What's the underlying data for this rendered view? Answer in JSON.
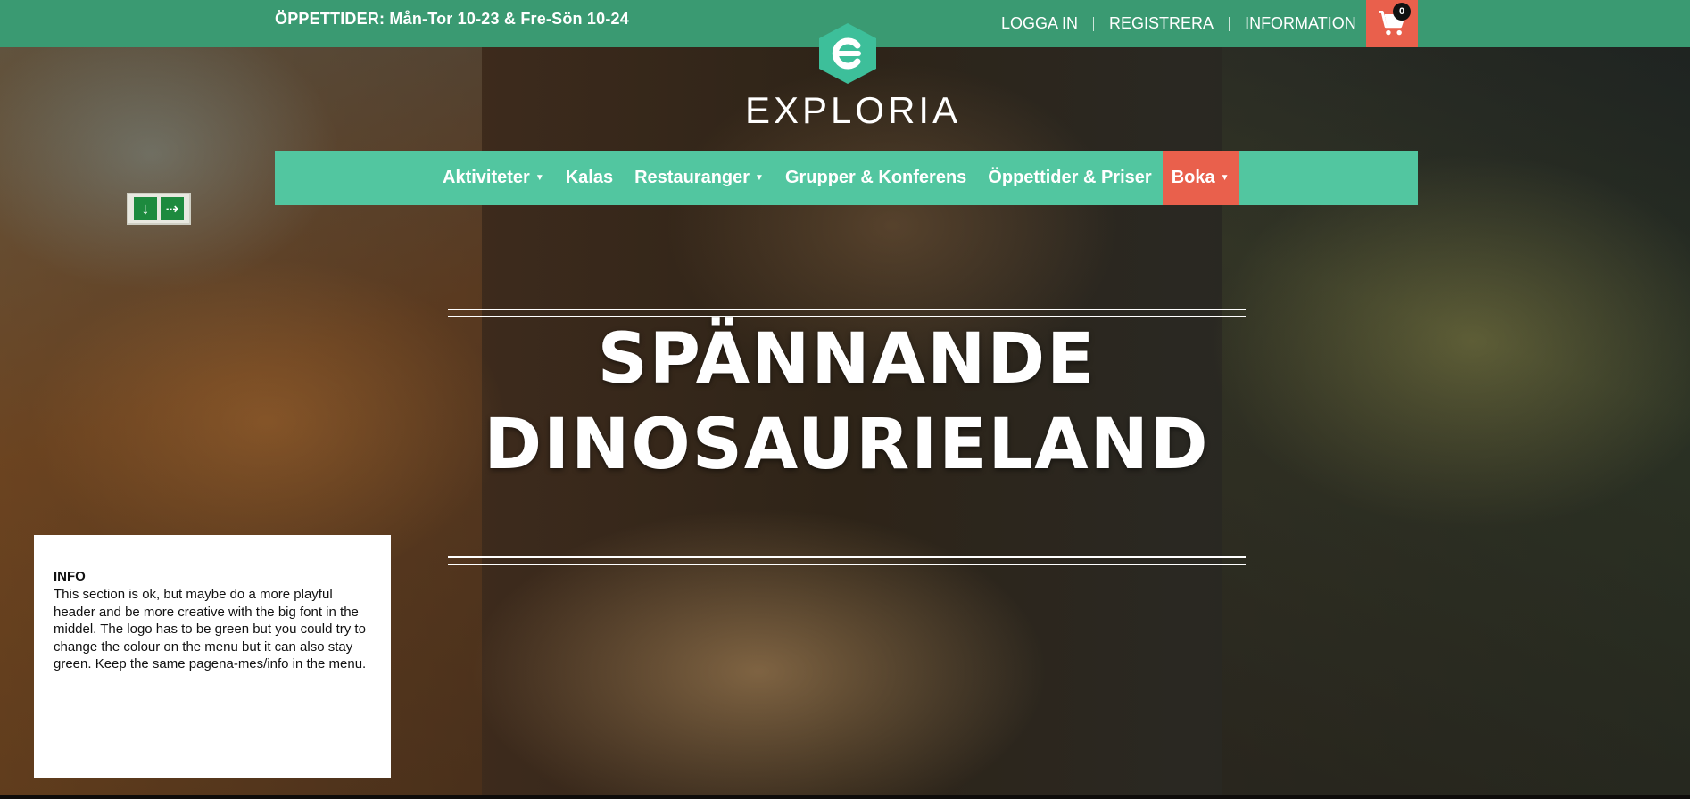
{
  "topbar": {
    "hours_label": "ÖPPETTIDER:",
    "hours_value": "Mån-Tor 10-23 & Fre-Sön 10-24",
    "links": [
      "LOGGA IN",
      "REGISTRERA",
      "INFORMATION"
    ],
    "cart_count": "0",
    "cart_icon": "cart-icon"
  },
  "logo": {
    "text": "EXPLORIA",
    "icon": "exploria-logo-icon"
  },
  "nav": {
    "items": [
      {
        "label": "Aktiviteter",
        "has_dropdown": true
      },
      {
        "label": "Kalas",
        "has_dropdown": false
      },
      {
        "label": "Restauranger",
        "has_dropdown": true
      },
      {
        "label": "Grupper & Konferens",
        "has_dropdown": false
      },
      {
        "label": "Öppettider & Priser",
        "has_dropdown": false
      },
      {
        "label": "Boka",
        "has_dropdown": true
      }
    ]
  },
  "hero": {
    "line1": "SPÄNNANDE",
    "line2": "DINOSAURIELAND"
  },
  "info": {
    "title": "INFO",
    "text": "This section is ok, but maybe do a more playful header and be more creative with the big font in the middel. The logo has to be green but you could try to change the colour on the menu but it can also stay green. Keep the same pagena-mes/info in the menu."
  },
  "colors": {
    "topbar": "#3a9a72",
    "nav": "#52c6a0",
    "accent": "#e9604c",
    "logo": "#3dbf9a"
  }
}
